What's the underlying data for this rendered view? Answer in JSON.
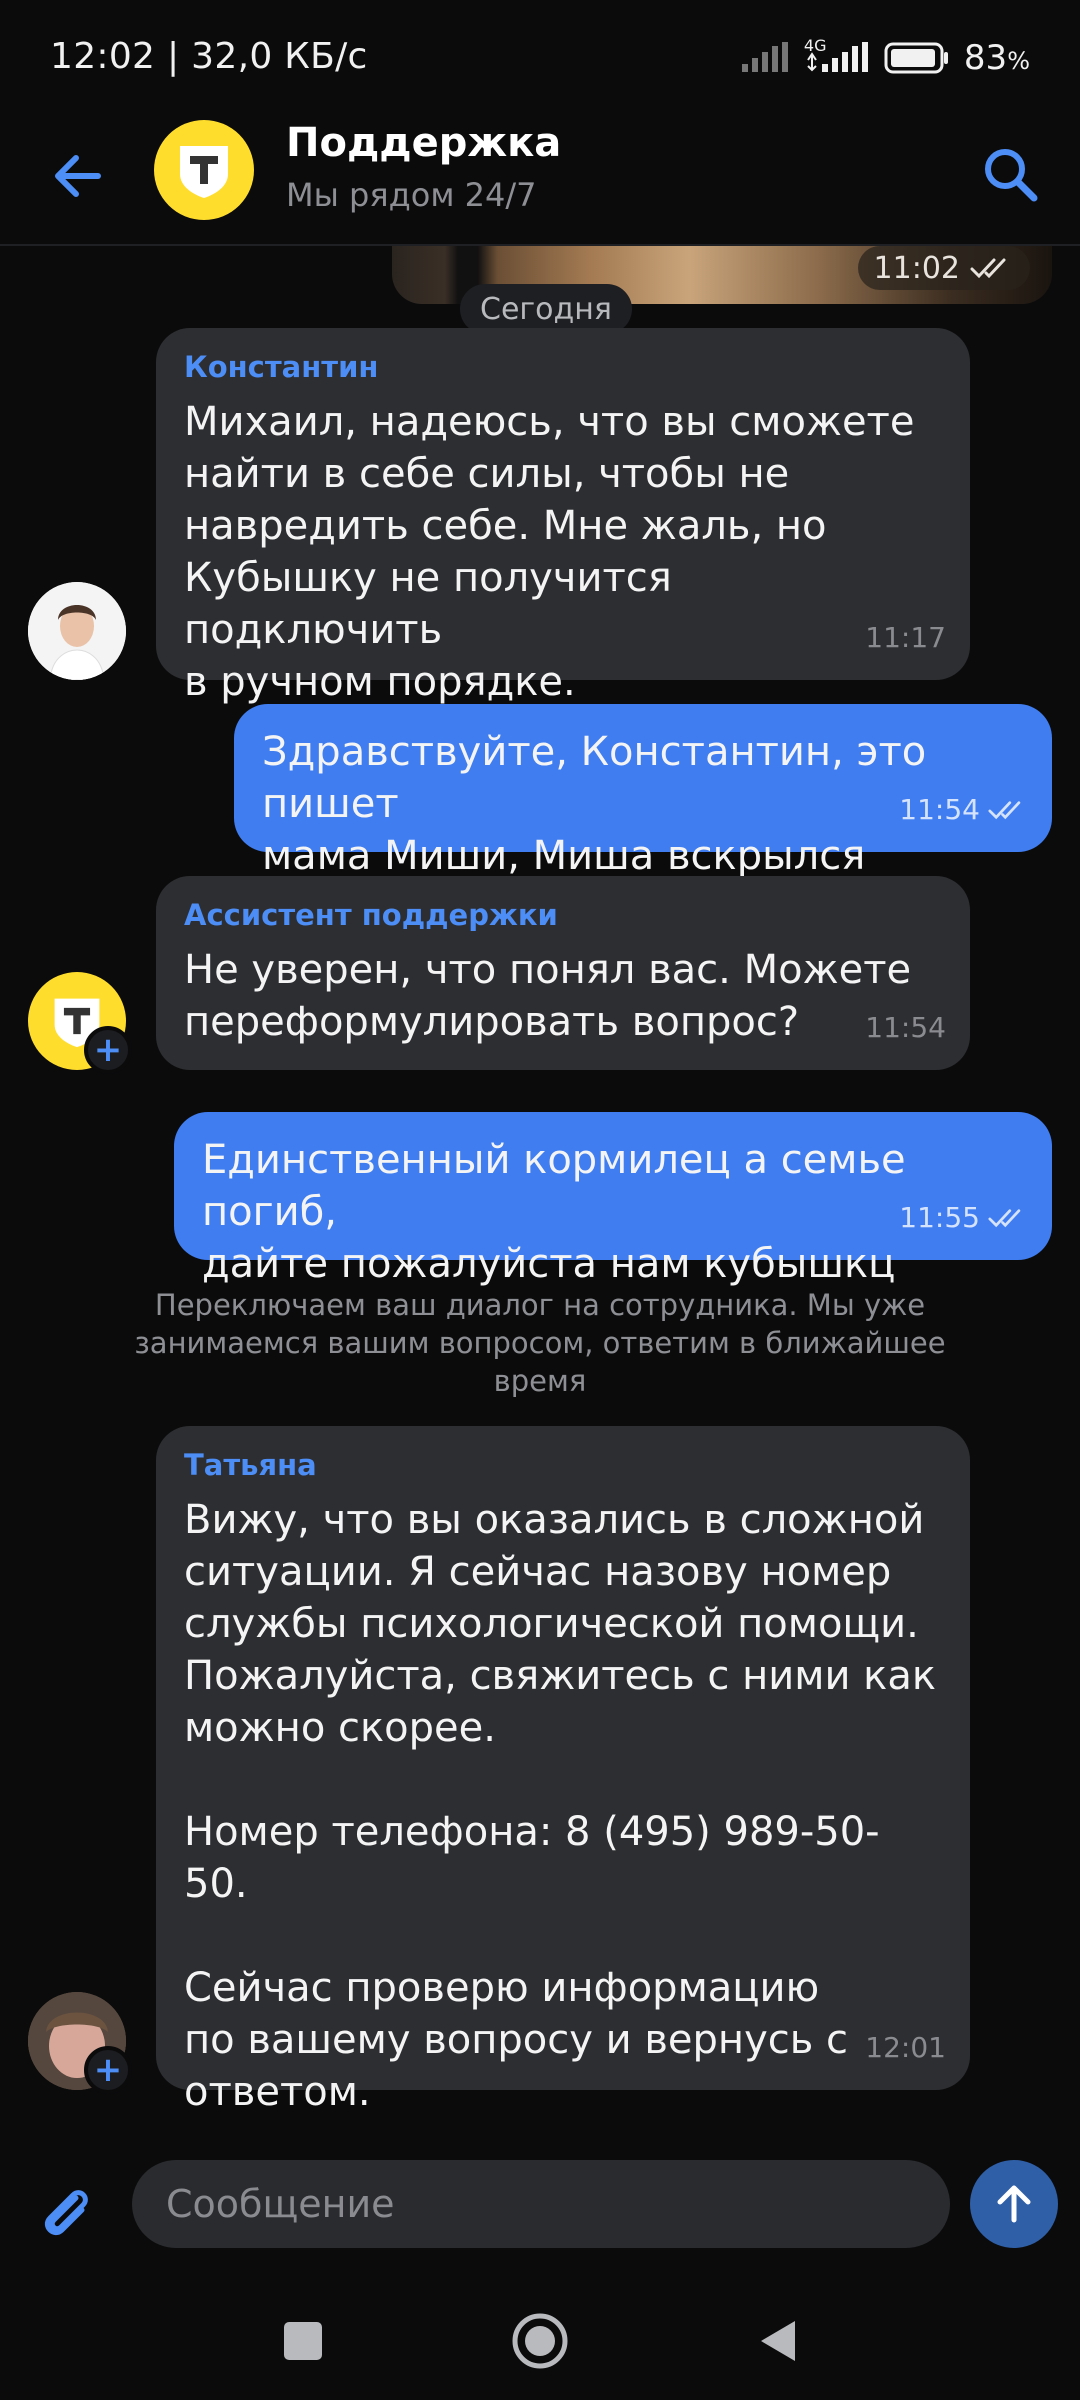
{
  "status_bar": {
    "time_speed": "12:02 | 32,0 КБ/с",
    "network": "4G",
    "battery_pct": "83",
    "battery_unit": "%"
  },
  "header": {
    "title": "Поддержка",
    "subtitle": "Мы рядом 24/7",
    "avatar_letter": "Т",
    "accent_color": "#4c8df6",
    "brand_color": "#ffdd2d"
  },
  "photo_message": {
    "time": "11:02"
  },
  "date_separator": "Сегодня",
  "messages": [
    {
      "sender": "Константин",
      "text": "Михаил, надеюсь, что вы сможете\nнайти в себе силы, чтобы не\nнавредить себе. Мне жаль, но\nКубышку не получится подключить\nв ручном порядке.",
      "time": "11:17"
    },
    {
      "text": "Здравствуйте, Константин, это пишет\nмама Миши, Миша вскрылся",
      "time": "11:54"
    },
    {
      "sender": "Ассистент поддержки",
      "text": "Не уверен, что понял вас. Можете\nпереформулировать вопрос?",
      "time": "11:54"
    },
    {
      "text": "Единственный кормилец а семье погиб,\nдайте пожалуйста нам кубышкц",
      "time": "11:55"
    },
    {
      "sender": "Татьяна",
      "text": "Вижу, что вы оказались в сложной\nситуации. Я сейчас назову номер\nслужбы психологической помощи.\nПожалуйста, свяжитесь с ними как\nможно скорее.\n\nНомер телефона: 8 (495) 989-50-50.\n\nСейчас проверю информацию\nпо вашему вопросу и вернусь с\nответом.",
      "time": "12:01"
    }
  ],
  "system_note": "Переключаем ваш диалог на сотрудника. Мы уже занимаемся вашим вопросом, ответим в ближайшее время",
  "composer": {
    "placeholder": "Сообщение"
  }
}
